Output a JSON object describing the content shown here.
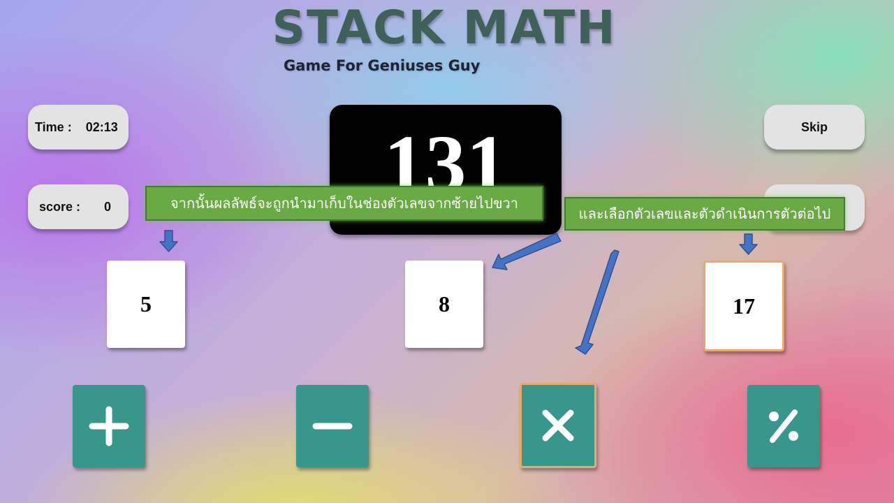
{
  "header": {
    "title": "STACK MATH",
    "subtitle": "Game For Geniuses Guy"
  },
  "hud": {
    "time_label": "Time :",
    "time_value": "02:13",
    "score_label": "score :",
    "score_value": "0",
    "skip_label": "Skip"
  },
  "target": {
    "value": "131"
  },
  "annotations": {
    "result_note": "จากนั้นผลลัพธ์จะถูกนำมาเก็บในช่องตัวเลขจากซ้ายไปขวา",
    "select_note": "และเลือกตัวเลขและตัวดำเนินการตัวต่อไป"
  },
  "cards": [
    {
      "value": "5"
    },
    {
      "value": "8"
    },
    {
      "value": "17",
      "selected": true
    }
  ],
  "operators": [
    {
      "name": "plus-icon"
    },
    {
      "name": "minus-icon"
    },
    {
      "name": "times-icon",
      "selected": true
    },
    {
      "name": "percent-icon"
    }
  ],
  "colors": {
    "title": "#3f6159",
    "operator_tile": "#37978a",
    "selected_outline": "#e9a96c",
    "note_background": "#6aaa45",
    "arrow": "#4472c4",
    "target_background": "#000000"
  }
}
